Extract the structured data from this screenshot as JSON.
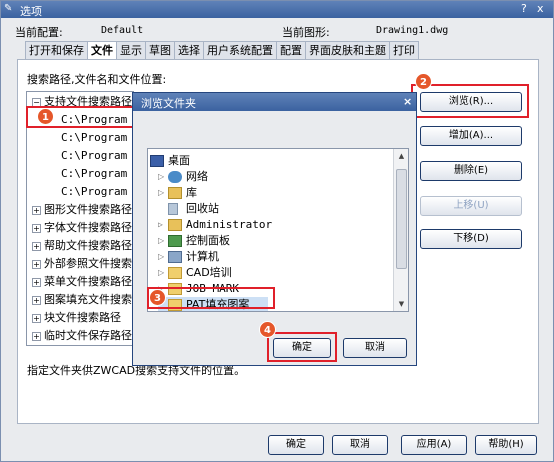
{
  "window": {
    "title": "选项",
    "help": "?",
    "close": "x"
  },
  "header": {
    "profile_label": "当前配置:",
    "profile_value": "Default",
    "drawing_label": "当前图形:",
    "drawing_value": "Drawing1.dwg"
  },
  "tabs": [
    "打开和保存",
    "文件",
    "显示",
    "草图",
    "选择",
    "用户系统配置",
    "配置",
    "界面皮肤和主题",
    "打印"
  ],
  "files": {
    "section_label": "搜索路径,文件名和文件位置:",
    "tree": [
      {
        "label": "支持文件搜索路径",
        "expander": "−"
      },
      {
        "label": "C:\\Program Fi"
      },
      {
        "label": "C:\\Program Fi"
      },
      {
        "label": "C:\\Program Fi"
      },
      {
        "label": "C:\\Program Fi"
      },
      {
        "label": "C:\\Program Fi"
      },
      {
        "label": "图形文件搜索路径",
        "expander": "+"
      },
      {
        "label": "字体文件搜索路径",
        "expander": "+"
      },
      {
        "label": "帮助文件搜索路径",
        "expander": "+"
      },
      {
        "label": "外部参照文件搜索",
        "expander": "+"
      },
      {
        "label": "菜单文件搜索路径",
        "expander": "+"
      },
      {
        "label": "图案填充文件搜索",
        "expander": "+"
      },
      {
        "label": "块文件搜索路径",
        "expander": "+"
      },
      {
        "label": "临时文件保存路径",
        "expander": "+"
      }
    ],
    "buttons": {
      "browse": "浏览(R)...",
      "add": "增加(A)...",
      "delete": "删除(E)",
      "up": "上移(U)",
      "down": "下移(D)"
    },
    "description": "指定文件夹供ZWCAD搜索支持文件的位置。"
  },
  "footer": {
    "ok": "确定",
    "cancel": "取消",
    "apply": "应用(A)",
    "help": "帮助(H)"
  },
  "badges": [
    "1",
    "2",
    "3",
    "4"
  ],
  "browse_dialog": {
    "title": "浏览文件夹",
    "close": "×",
    "items": [
      {
        "label": "桌面",
        "icon": "desktop-icon"
      },
      {
        "label": "网络",
        "icon": "network-icon"
      },
      {
        "label": "库",
        "icon": "library-icon"
      },
      {
        "label": "回收站",
        "icon": "recycle-bin-icon"
      },
      {
        "label": "Administrator",
        "icon": "user-folder-icon"
      },
      {
        "label": "控制面板",
        "icon": "control-panel-icon"
      },
      {
        "label": "计算机",
        "icon": "computer-icon"
      },
      {
        "label": "CAD培训",
        "icon": "folder-icon"
      },
      {
        "label": "JOB MARK",
        "icon": "folder-icon"
      },
      {
        "label": "PAT填充图案",
        "icon": "folder-icon"
      }
    ],
    "ok": "确定",
    "cancel": "取消"
  },
  "colors": {
    "accent": "#e0202a",
    "titlebar": "#3b62a0",
    "badge": "#e5572a"
  }
}
